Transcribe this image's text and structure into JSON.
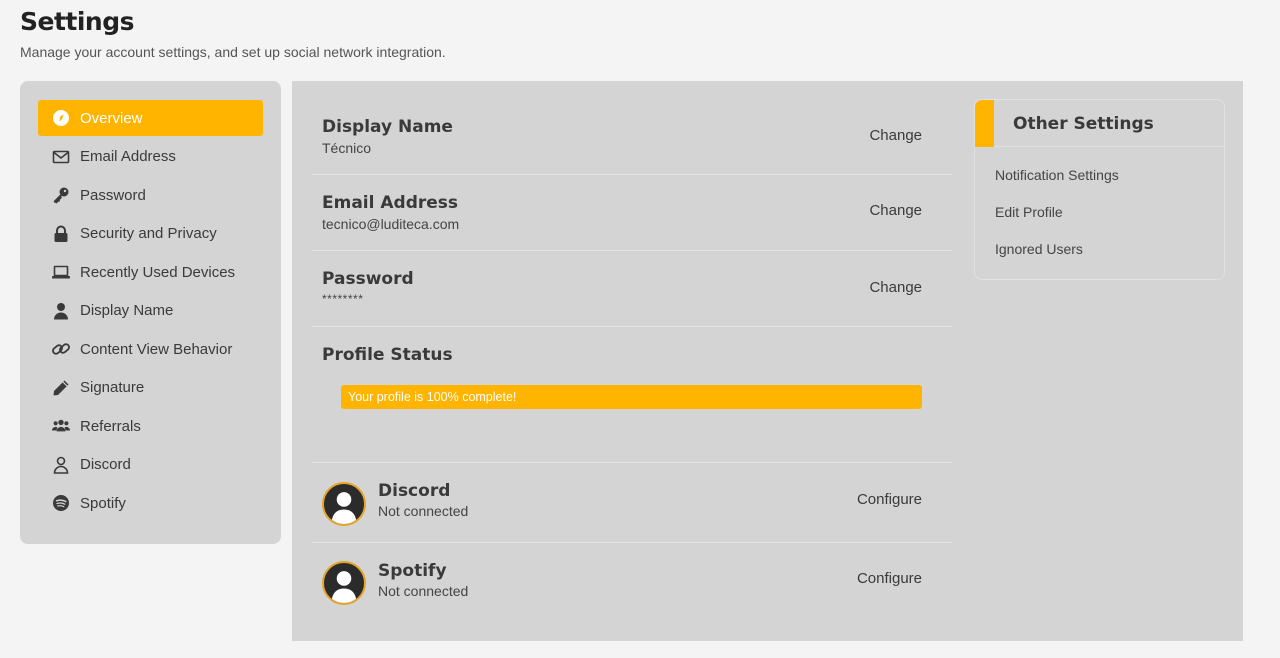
{
  "header": {
    "title": "Settings",
    "subtitle": "Manage your account settings, and set up social network integration."
  },
  "sidebar": {
    "items": [
      {
        "label": "Overview",
        "icon": "compass-icon",
        "active": true
      },
      {
        "label": "Email Address",
        "icon": "envelope-icon"
      },
      {
        "label": "Password",
        "icon": "key-icon"
      },
      {
        "label": "Security and Privacy",
        "icon": "lock-icon"
      },
      {
        "label": "Recently Used Devices",
        "icon": "laptop-icon"
      },
      {
        "label": "Display Name",
        "icon": "user-icon"
      },
      {
        "label": "Content View Behavior",
        "icon": "link-icon"
      },
      {
        "label": "Signature",
        "icon": "pencil-icon"
      },
      {
        "label": "Referrals",
        "icon": "users-icon"
      },
      {
        "label": "Discord",
        "icon": "user-outline-icon"
      },
      {
        "label": "Spotify",
        "icon": "spotify-icon"
      }
    ]
  },
  "main": {
    "display_name": {
      "title": "Display Name",
      "value": "Técnico",
      "action": "Change"
    },
    "email": {
      "title": "Email Address",
      "value": "tecnico@luditeca.com",
      "action": "Change"
    },
    "password": {
      "title": "Password",
      "value": "********",
      "action": "Change"
    },
    "profile_status": {
      "title": "Profile Status",
      "progress_text": "Your profile is 100% complete!",
      "progress_percent": 100
    },
    "connections": [
      {
        "title": "Discord",
        "status": "Not connected",
        "action": "Configure"
      },
      {
        "title": "Spotify",
        "status": "Not connected",
        "action": "Configure"
      }
    ]
  },
  "other_settings": {
    "title": "Other Settings",
    "links": [
      "Notification Settings",
      "Edit Profile",
      "Ignored Users"
    ]
  },
  "colors": {
    "accent": "#ffb400",
    "panel": "#d4d4d4",
    "background": "#f4f4f4"
  }
}
